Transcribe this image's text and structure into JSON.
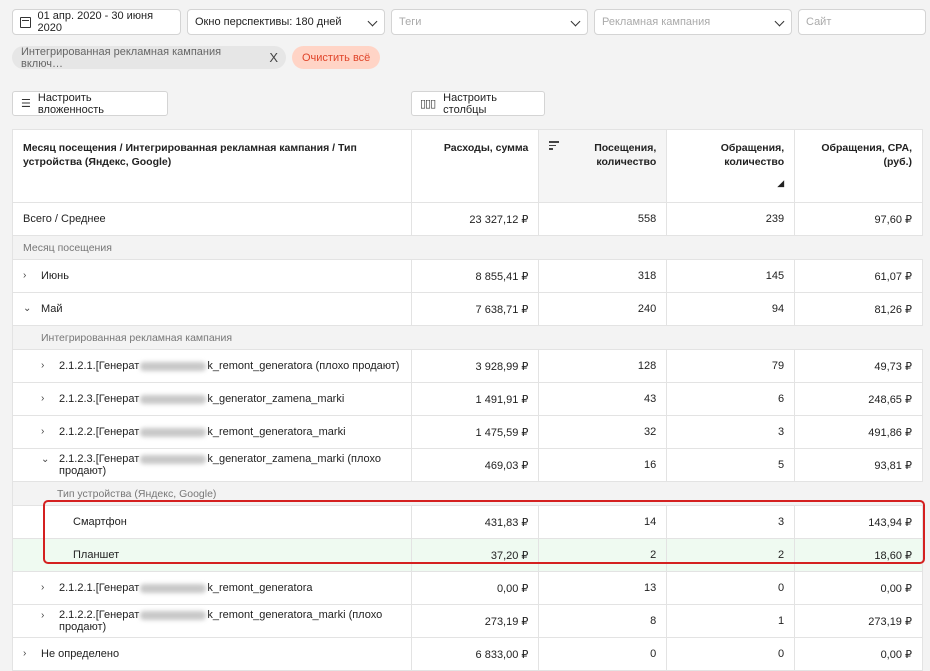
{
  "filters": {
    "date_range": "01 апр. 2020 - 30 июня 2020",
    "window_label": "Окно перспективы:",
    "window_value": "180 дней",
    "tags_placeholder": "Теги",
    "campaign_placeholder": "Рекламная кампания",
    "site_placeholder": "Сайт"
  },
  "chips": {
    "active_filter": "Интегрированная рекламная кампания включ…",
    "remove_icon": "X",
    "clear_all": "Очистить всё"
  },
  "toolbar": {
    "nesting_label": "Настроить вложенность",
    "columns_label": "Настроить столбцы"
  },
  "table": {
    "headers": {
      "dimension": "Месяц посещения / Интегрированная рекламная кампания / Тип устройства (Яндекс, Google)",
      "spend": "Расходы, сумма",
      "visits_line1": "Посещения,",
      "visits_line2": "количество",
      "requests_line1": "Обращения,",
      "requests_line2": "количество",
      "cpa_line1": "Обращения, CPA,",
      "cpa_line2": "(руб.)"
    },
    "sections": {
      "month": "Месяц посещения",
      "campaign": "Интегрированная рекламная кампания",
      "device": "Тип устройства (Яндекс, Google)"
    },
    "total": {
      "name": "Всего / Среднее",
      "spend": "23 327,12 ₽",
      "visits": "558",
      "requests": "239",
      "cpa": "97,60 ₽"
    },
    "june": {
      "name": "Июнь",
      "spend": "8 855,41 ₽",
      "visits": "318",
      "requests": "145",
      "cpa": "61,07 ₽"
    },
    "may": {
      "name": "Май",
      "spend": "7 638,71 ₽",
      "visits": "240",
      "requests": "94",
      "cpa": "81,26 ₽"
    },
    "camp1": {
      "prefix": "2.1.2.1.[Генерат",
      "suffix": "k_remont_generatora (плохо продают)",
      "spend": "3 928,99 ₽",
      "visits": "128",
      "requests": "79",
      "cpa": "49,73 ₽"
    },
    "camp2": {
      "prefix": "2.1.2.3.[Генерат",
      "suffix": "k_generator_zamena_marki",
      "spend": "1 491,91 ₽",
      "visits": "43",
      "requests": "6",
      "cpa": "248,65 ₽"
    },
    "camp3": {
      "prefix": "2.1.2.2.[Генерат",
      "suffix": "k_remont_generatora_marki",
      "spend": "1 475,59 ₽",
      "visits": "32",
      "requests": "3",
      "cpa": "491,86 ₽"
    },
    "camp4": {
      "prefix": "2.1.2.3.[Генерат",
      "suffix": "k_generator_zamena_marki (плохо",
      "line2": "продают)",
      "spend": "469,03 ₽",
      "visits": "16",
      "requests": "5",
      "cpa": "93,81 ₽"
    },
    "smartphone": {
      "name": "Смартфон",
      "spend": "431,83 ₽",
      "visits": "14",
      "requests": "3",
      "cpa": "143,94 ₽"
    },
    "tablet": {
      "name": "Планшет",
      "spend": "37,20 ₽",
      "visits": "2",
      "requests": "2",
      "cpa": "18,60 ₽"
    },
    "camp5": {
      "prefix": "2.1.2.1.[Генерат",
      "suffix": "k_remont_generatora",
      "spend": "0,00 ₽",
      "visits": "13",
      "requests": "0",
      "cpa": "0,00 ₽"
    },
    "camp6": {
      "prefix": "2.1.2.2.[Генерат",
      "suffix": "k_remont_generatora_marki (плохо",
      "line2": "продают)",
      "spend": "273,19 ₽",
      "visits": "8",
      "requests": "1",
      "cpa": "273,19 ₽"
    },
    "undefined_row": {
      "name": "Не определено",
      "spend": "6 833,00 ₽",
      "visits": "0",
      "requests": "0",
      "cpa": "0,00 ₽"
    }
  }
}
